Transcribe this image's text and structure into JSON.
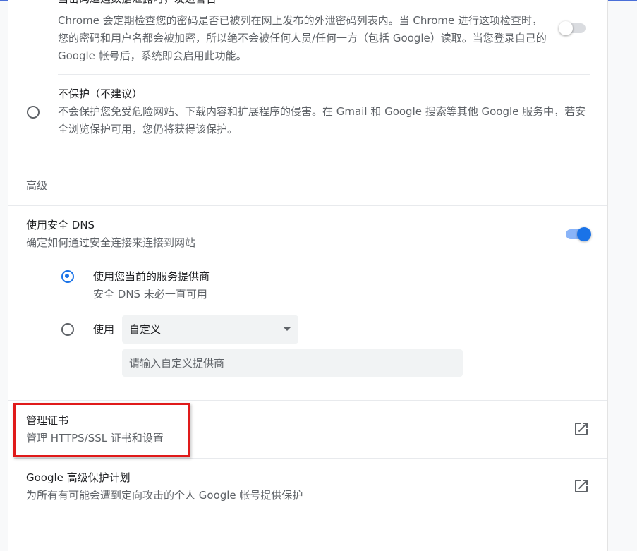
{
  "leak_check": {
    "title_partial": "当密码遭遇数据泄露时，发送警告",
    "description": "Chrome 会定期检查您的密码是否已被列在网上发布的外泄密码列表内。当 Chrome 进行这项检查时，您的密码和用户名都会被加密，所以绝不会被任何人员/任何一方（包括 Google）读取。当您登录自己的 Google 帐号后，系统即会启用此功能。",
    "toggle_state": "off"
  },
  "no_protection": {
    "title": "不保护（不建议）",
    "description": "不会保护您免受危险网站、下载内容和扩展程序的侵害。在 Gmail 和 Google 搜索等其他 Google 服务中，若安全浏览保护可用，您仍将获得该保护。"
  },
  "advanced": {
    "heading": "高级"
  },
  "secure_dns": {
    "title": "使用安全 DNS",
    "description": "确定如何通过安全连接来连接到网站",
    "toggle_state": "on",
    "option_current": {
      "label": "使用您当前的服务提供商",
      "sublabel": "安全 DNS 未必一直可用"
    },
    "option_custom": {
      "label": "使用",
      "select_value": "自定义",
      "input_placeholder": "请输入自定义提供商"
    }
  },
  "manage_certs": {
    "title": "管理证书",
    "description": "管理 HTTPS/SSL 证书和设置",
    "icon": "open-in-new-icon"
  },
  "advanced_protection": {
    "title": "Google 高级保护计划",
    "description": "为所有有可能会遭到定向攻击的个人 Google 帐号提供保护",
    "icon": "open-in-new-icon"
  },
  "colors": {
    "accent": "#1a73e8",
    "highlight": "#e01a1a"
  }
}
